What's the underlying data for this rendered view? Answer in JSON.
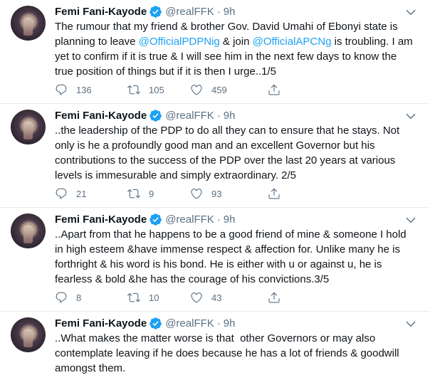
{
  "tweets": [
    {
      "author": "Femi Fani-Kayode",
      "handle": "@realFFK",
      "separator": "·",
      "time": "9h",
      "text_parts": [
        "The rumour that my friend & brother Gov. David Umahi of Ebonyi state is planning to leave ",
        "@OfficialPDPNig",
        " & join ",
        "@OfficialAPCNg",
        " is troubling. I am yet to confirm if it is true & I will see him in the next few days to know the true position of things but if it is then I urge..1/5"
      ],
      "replies": "136",
      "retweets": "105",
      "likes": "459"
    },
    {
      "author": "Femi Fani-Kayode",
      "handle": "@realFFK",
      "separator": "·",
      "time": "9h",
      "text": "..the leadership of the PDP to do all they can to ensure that he stays. Not only is he a profoundly good man and an excellent Governor but his contributions to the success of the PDP over the last 20 years at various levels is immesurable and simply extraordinary. 2/5",
      "replies": "21",
      "retweets": "9",
      "likes": "93"
    },
    {
      "author": "Femi Fani-Kayode",
      "handle": "@realFFK",
      "separator": "·",
      "time": "9h",
      "text": "..Apart from that he happens to be a good friend of mine & someone I hold in high esteem &have immense respect & affection for. Unlike many he is forthright & his word is his bond. He is either with u or against u, he is fearless & bold &he has the courage of his convictions.3/5",
      "replies": "8",
      "retweets": "10",
      "likes": "43"
    },
    {
      "author": "Femi Fani-Kayode",
      "handle": "@realFFK",
      "separator": "·",
      "time": "9h",
      "text": "..What makes the matter worse is that  other Governors or may also contemplate leaving if he does because he has a lot of friends & goodwill amongst them."
    }
  ],
  "colors": {
    "accent": "#1da1f2",
    "secondary_text": "#5b7083",
    "primary_text": "#0f1419",
    "divider": "#e6ecf0"
  },
  "icons": [
    "verified-badge-icon",
    "more-options-icon",
    "reply-icon",
    "retweet-icon",
    "like-icon",
    "share-icon"
  ]
}
